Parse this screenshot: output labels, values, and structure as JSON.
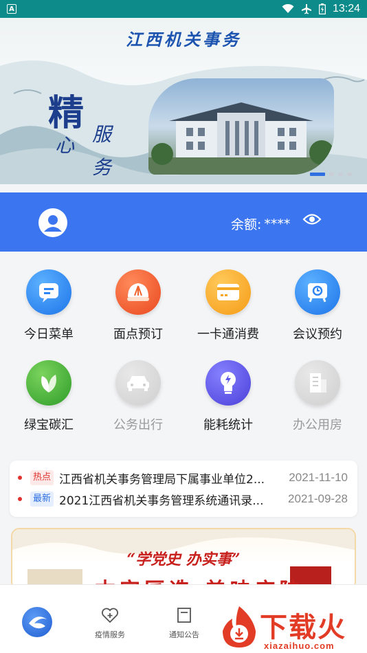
{
  "status_bar": {
    "time": "13:24"
  },
  "banner": {
    "title": "江西机关事务",
    "calligraphy_big": "精",
    "calligraphy_1": "心",
    "calligraphy_2": "服",
    "calligraphy_3": "务",
    "slide_count": 4,
    "active_slide": 1
  },
  "account": {
    "balance_label": "余额:",
    "balance_value": "****"
  },
  "services": [
    {
      "label": "今日菜单",
      "icon": "menu-card-icon",
      "color": "#2f86f2",
      "enabled": true
    },
    {
      "label": "面点预订",
      "icon": "bun-icon",
      "color": "#f0642e",
      "enabled": true
    },
    {
      "label": "一卡通消费",
      "icon": "card-icon",
      "color": "#f5a623",
      "enabled": true
    },
    {
      "label": "会议预约",
      "icon": "meeting-icon",
      "color": "#2f86f2",
      "enabled": true
    },
    {
      "label": "绿宝碳汇",
      "icon": "leaf-icon",
      "color": "#4cb83a",
      "enabled": true
    },
    {
      "label": "公务出行",
      "icon": "car-icon",
      "color": "#cfcfcf",
      "enabled": false
    },
    {
      "label": "能耗统计",
      "icon": "bulb-icon",
      "color": "#5a55e6",
      "enabled": true
    },
    {
      "label": "办公用房",
      "icon": "building-icon",
      "color": "#cfcfcf",
      "enabled": false
    }
  ],
  "news": [
    {
      "tag": "热点",
      "title": "江西省机关事务管理局下属事业单位2...",
      "date": "2021-11-10"
    },
    {
      "tag": "最新",
      "title": "2021江西省机关事务管理系统通讯录...",
      "date": "2021-09-28"
    }
  ],
  "promo": {
    "title": "“学党史 办实事”",
    "subtitle": "本宫匠造 美味店陆"
  },
  "bottom_nav": [
    {
      "label": "",
      "icon": "home-logo-icon"
    },
    {
      "label": "疫情服务",
      "icon": "heart-plus-icon"
    },
    {
      "label": "通知公告",
      "icon": "notice-icon"
    }
  ],
  "watermark": {
    "text": "下载火",
    "url": "xiazaihuo.com"
  },
  "colors": {
    "primary": "#3b76f0",
    "hot_tag": "#e0332f",
    "status_bar": "#0d8a8a"
  }
}
